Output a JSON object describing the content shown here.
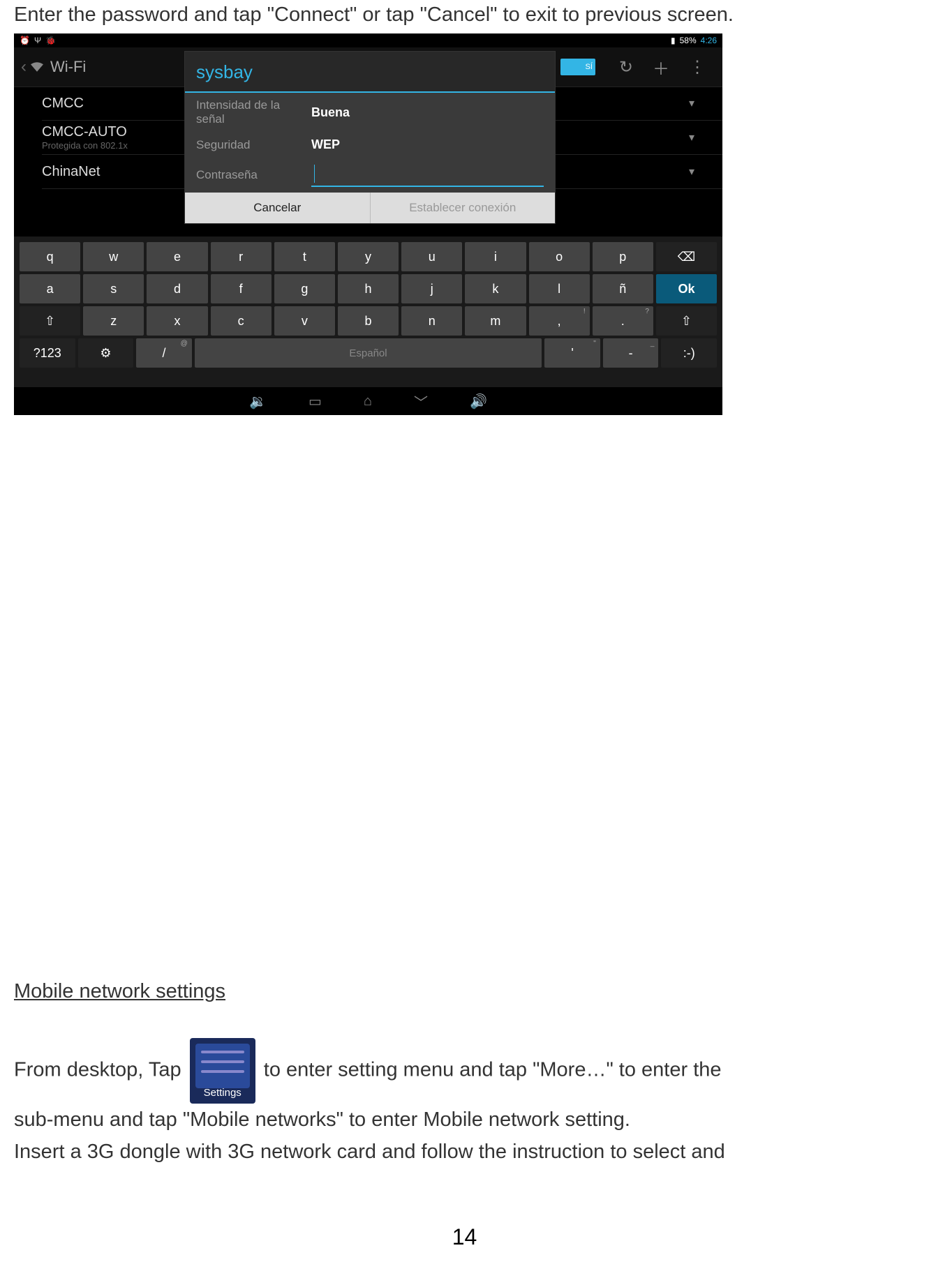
{
  "doc": {
    "intro": "Enter the password and tap \"Connect\" or tap \"Cancel\" to exit to previous screen.",
    "section_heading": "Mobile network settings",
    "body_p1_a": "From desktop, Tap",
    "body_p1_settings": "Settings",
    "body_p1_b": " to enter setting menu and tap \"More…\" to enter the",
    "body_p2": "sub-menu and tap \"Mobile networks\" to enter Mobile network setting.",
    "body_p3": "Insert a 3G dongle with 3G network card and follow the instruction to select and",
    "page_number": "14"
  },
  "status": {
    "battery": "58%",
    "time": "4:26"
  },
  "wifi_screen": {
    "title": "Wi-Fi",
    "toggle": "SÍ",
    "networks": [
      {
        "name": "CMCC",
        "sub": ""
      },
      {
        "name": "CMCC-AUTO",
        "sub": "Protegida con 802.1x"
      },
      {
        "name": "ChinaNet",
        "sub": ""
      }
    ]
  },
  "dialog": {
    "title": "sysbay",
    "signal_label": "Intensidad de la señal",
    "signal_value": "Buena",
    "security_label": "Seguridad",
    "security_value": "WEP",
    "password_label": "Contraseña",
    "cancel": "Cancelar",
    "connect": "Establecer conexión"
  },
  "keyboard": {
    "row1": [
      "q",
      "w",
      "e",
      "r",
      "t",
      "y",
      "u",
      "i",
      "o",
      "p"
    ],
    "row2": [
      "a",
      "s",
      "d",
      "f",
      "g",
      "h",
      "j",
      "k",
      "l",
      "ñ"
    ],
    "row3": [
      "z",
      "x",
      "c",
      "v",
      "b",
      "n",
      "m",
      ",",
      "."
    ],
    "shift": "⇧",
    "bksp": "⌫",
    "ok": "Ok",
    "num": "?123",
    "slash": "/",
    "space": "Español",
    "apos": "'",
    "dash": "-",
    "smile": ":-)",
    "slash_sup": "@",
    "comma_sup": "!",
    "period_sup": "?",
    "apos_sup": "\"",
    "dash_sup": "_"
  }
}
